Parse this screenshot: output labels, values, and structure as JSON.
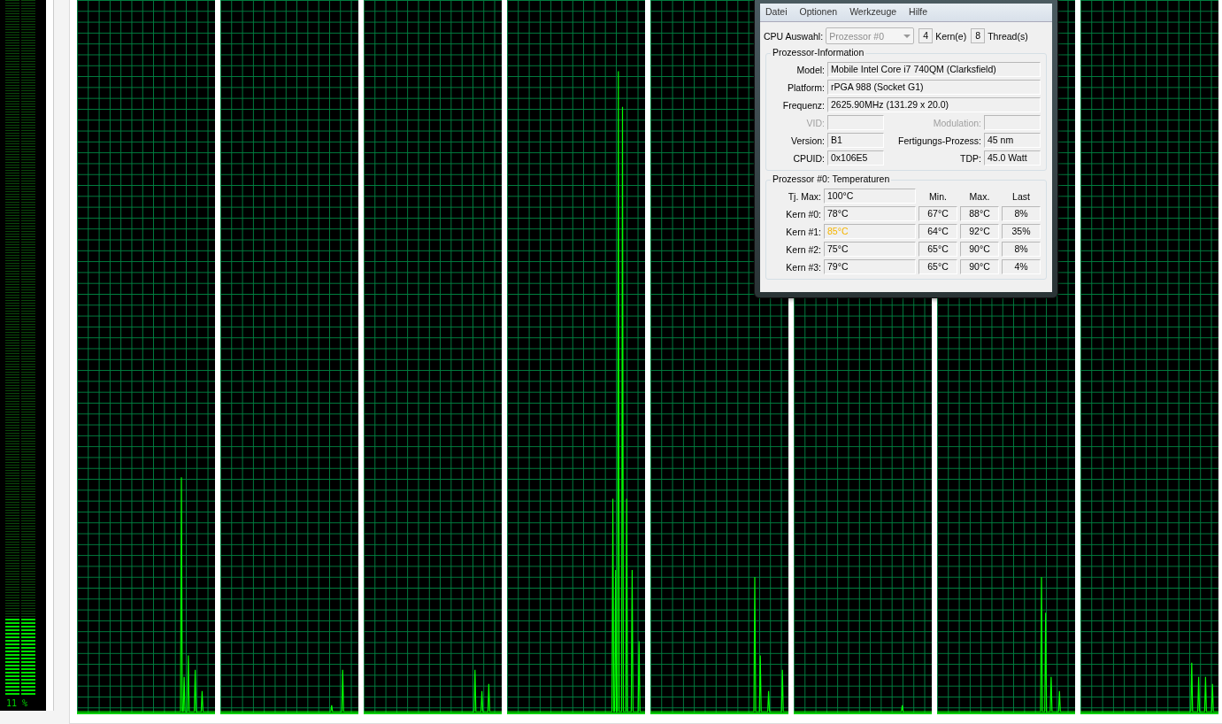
{
  "usage_meter": {
    "level": 0.11,
    "reading": "11 %"
  },
  "core_temp_window": {
    "menu": [
      "Datei",
      "Optionen",
      "Werkzeuge",
      "Hilfe"
    ],
    "cpu_select": {
      "label": "CPU Auswahl:",
      "value": "Prozessor #0",
      "disabled": true,
      "cores": "4",
      "cores_label": "Kern(e)",
      "threads": "8",
      "threads_label": "Thread(s)"
    },
    "processor_info": {
      "title": "Prozessor-Information",
      "wide_fields": [
        {
          "label": "Model:",
          "value": "Mobile Intel Core i7 740QM (Clarksfield)"
        },
        {
          "label": "Platform:",
          "value": "rPGA 988 (Socket G1)"
        },
        {
          "label": "Frequenz:",
          "value": "2625.90MHz (131.29 x 20.0)"
        }
      ],
      "pair_fields": [
        {
          "label": "VID:",
          "disabled": true
        },
        {
          "label": "Modulation:",
          "disabled": true
        },
        {
          "label": "Version:",
          "value": "B1",
          "disabled": false
        },
        {
          "label": "Fertigungs-Prozess:",
          "value": "45 nm",
          "disabled": false
        },
        {
          "label": "CPUID:",
          "value": "0x106E5",
          "disabled": false
        },
        {
          "label": "TDP:",
          "value": "45.0 Watt",
          "disabled": false
        }
      ]
    },
    "temperatures": {
      "title": "Prozessor #0: Temperaturen",
      "tj_max_label": "Tj. Max:",
      "tj_max": "100°C",
      "columns": [
        "Min.",
        "Max.",
        "Last"
      ],
      "cores": [
        {
          "label": "Kern #0:",
          "temp": "78°C",
          "hot": false,
          "min": "67°C",
          "max": "88°C",
          "load": "8%"
        },
        {
          "label": "Kern #1:",
          "temp": "85°C",
          "hot": true,
          "min": "64°C",
          "max": "92°C",
          "load": "35%"
        },
        {
          "label": "Kern #2:",
          "temp": "75°C",
          "hot": false,
          "min": "65°C",
          "max": "90°C",
          "load": "8%"
        },
        {
          "label": "Kern #3:",
          "temp": "79°C",
          "hot": false,
          "min": "65°C",
          "max": "90°C",
          "load": "4%"
        }
      ]
    }
  }
}
